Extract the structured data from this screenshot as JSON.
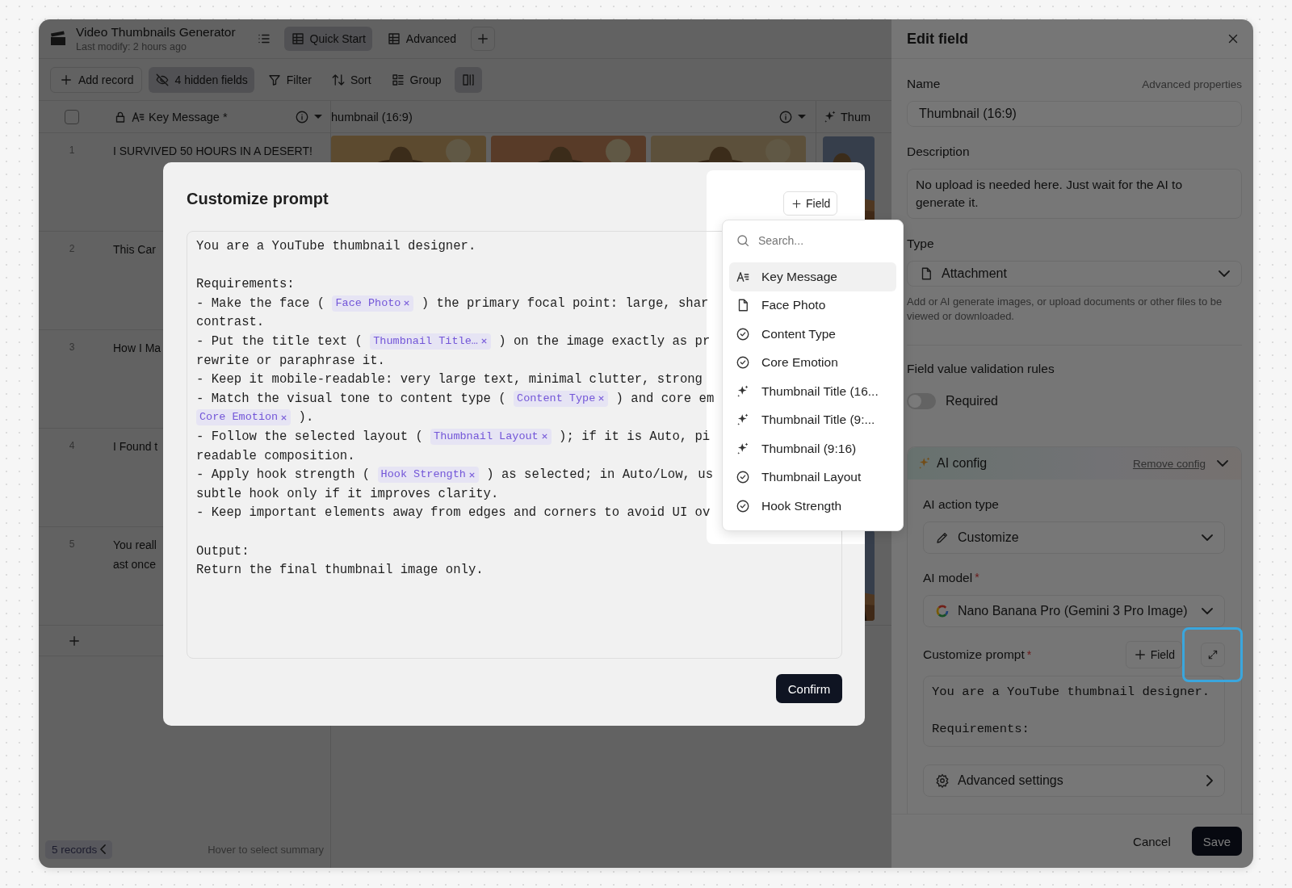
{
  "app": {
    "title": "Video Thumbnails Generator",
    "subtitle": "Last modify: 2 hours ago"
  },
  "views": [
    {
      "label": "Quick Start",
      "selected": true
    },
    {
      "label": "Advanced",
      "selected": false
    }
  ],
  "toolbar": [
    {
      "kind": "add",
      "label": "Add record",
      "active": false
    },
    {
      "kind": "hidden",
      "label": "4 hidden fields",
      "active": true
    },
    {
      "kind": "filter",
      "label": "Filter",
      "active": false
    },
    {
      "kind": "sort",
      "label": "Sort",
      "active": false
    },
    {
      "kind": "group",
      "label": "Group",
      "active": false
    },
    {
      "kind": "layout",
      "active": true
    }
  ],
  "select_all": {
    "checked": false
  },
  "columns": [
    {
      "kind": "primary",
      "label": "Key Message *"
    },
    {
      "kind": "clipped",
      "label": "humbnail (16:9)"
    },
    {
      "kind": "ai",
      "label": "Thum"
    }
  ],
  "rows": [
    {
      "number": "1",
      "text": [
        "I SURVIVED 50 HOURS IN A DESERT!"
      ],
      "thumbnails": [
        {
          "kind": "picture"
        },
        {
          "kind": "picture"
        },
        {
          "kind": "picture"
        }
      ],
      "preview": {
        "kind": "picture"
      }
    },
    {
      "number": "2",
      "text": [
        "This Car"
      ]
    },
    {
      "number": "3",
      "text": [
        "How I Ma"
      ]
    },
    {
      "number": "4",
      "text": [
        "I Found t"
      ]
    },
    {
      "number": "5",
      "text": [
        "You reall",
        "ast once"
      ],
      "preview": {
        "kind": "picture"
      }
    }
  ],
  "footer": {
    "records": "5 records",
    "summary_hint": "Hover to select summary"
  },
  "modal": {
    "title": "Customize prompt",
    "field_button": "Field",
    "confirm": "Confirm",
    "paragraphs": [
      {
        "lines": [
          {
            "segments": [
              {
                "kind": "text",
                "text": "You are a YouTube thumbnail designer."
              }
            ]
          }
        ]
      },
      {
        "lines": [
          {
            "segments": [
              {
                "kind": "text",
                "text": "Requirements:"
              }
            ]
          },
          {
            "segments": [
              {
                "kind": "text",
                "text": "- Make the face ( "
              },
              {
                "kind": "chip",
                "text": "Face Photo"
              },
              {
                "kind": "text",
                "text": " ) the primary focal point: large, shar"
              }
            ]
          },
          {
            "segments": [
              {
                "kind": "text",
                "text": "contrast."
              }
            ]
          },
          {
            "segments": [
              {
                "kind": "text",
                "text": "- Put the title text ( "
              },
              {
                "kind": "chip",
                "text": "Thumbnail Title…"
              },
              {
                "kind": "text",
                "text": " ) on the image exactly as pr"
              }
            ]
          },
          {
            "segments": [
              {
                "kind": "text",
                "text": "rewrite or paraphrase it."
              }
            ]
          },
          {
            "segments": [
              {
                "kind": "text",
                "text": "- Keep it mobile-readable: very large text, minimal clutter, strong"
              }
            ]
          },
          {
            "segments": [
              {
                "kind": "text",
                "text": "- Match the visual tone to content type ( "
              },
              {
                "kind": "chip",
                "text": "Content Type"
              },
              {
                "kind": "text",
                "text": " ) and core em"
              }
            ]
          },
          {
            "segments": [
              {
                "kind": "chip",
                "text": "Core Emotion"
              },
              {
                "kind": "text",
                "text": " )."
              }
            ]
          },
          {
            "segments": [
              {
                "kind": "text",
                "text": "- Follow the selected layout ( "
              },
              {
                "kind": "chip",
                "text": "Thumbnail Layout"
              },
              {
                "kind": "text",
                "text": " ); if it is Auto, pi"
              }
            ]
          },
          {
            "segments": [
              {
                "kind": "text",
                "text": "readable composition."
              }
            ]
          },
          {
            "segments": [
              {
                "kind": "text",
                "text": "- Apply hook strength ( "
              },
              {
                "kind": "chip",
                "text": "Hook Strength"
              },
              {
                "kind": "text",
                "text": " ) as selected; in Auto/Low, us"
              }
            ]
          },
          {
            "segments": [
              {
                "kind": "text",
                "text": "subtle hook only if it improves clarity."
              }
            ]
          },
          {
            "segments": [
              {
                "kind": "text",
                "text": "- Keep important elements away from edges and corners to avoid UI ov"
              }
            ]
          }
        ]
      },
      {
        "lines": [
          {
            "segments": [
              {
                "kind": "text",
                "text": "Output:"
              }
            ]
          },
          {
            "segments": [
              {
                "kind": "text",
                "text": "Return the final thumbnail image only."
              }
            ]
          }
        ]
      }
    ]
  },
  "dropdown": {
    "placeholder": "Search...",
    "items": [
      {
        "kind": "text",
        "label": "Key Message",
        "selected": true
      },
      {
        "kind": "attachment",
        "label": "Face Photo",
        "selected": false
      },
      {
        "kind": "select",
        "label": "Content Type",
        "selected": false
      },
      {
        "kind": "select",
        "label": "Core Emotion",
        "selected": false
      },
      {
        "kind": "ai",
        "label": "Thumbnail Title (16...",
        "selected": false
      },
      {
        "kind": "ai",
        "label": "Thumbnail Title (9:...",
        "selected": false
      },
      {
        "kind": "ai",
        "label": "Thumbnail (9:16)",
        "selected": false
      },
      {
        "kind": "select",
        "label": "Thumbnail Layout",
        "selected": false
      },
      {
        "kind": "select",
        "label": "Hook Strength",
        "selected": false
      }
    ]
  },
  "panel": {
    "title": "Edit field",
    "name_label": "Name",
    "advanced_link": "Advanced properties",
    "name_value": "Thumbnail (16:9)",
    "description_label": "Description",
    "description_value": "No upload is needed here. Just wait for the AI to generate it.",
    "type_label": "Type",
    "type_value": "Attachment",
    "type_help": "Add or AI generate images, or upload documents or other files to be viewed or downloaded.",
    "validation_title": "Field value validation rules",
    "required": {
      "label": "Required",
      "on": false
    },
    "ai_config": {
      "title": "AI config",
      "remove": "Remove config",
      "action_type_label": "AI action type",
      "action_type_value": "Customize",
      "model_label": "AI model",
      "model_required_mark": "*",
      "model_value": "Nano Banana Pro (Gemini 3 Pro Image)",
      "prompt_label": "Customize prompt",
      "prompt_required_mark": "*",
      "field_button": "Field",
      "prompt_paragraphs": [
        {
          "lines": [
            "You are a YouTube thumbnail designer."
          ]
        },
        {
          "lines": [
            "Requirements:"
          ]
        }
      ],
      "advanced_settings": "Advanced settings"
    },
    "cancel": "Cancel",
    "save": "Save"
  }
}
